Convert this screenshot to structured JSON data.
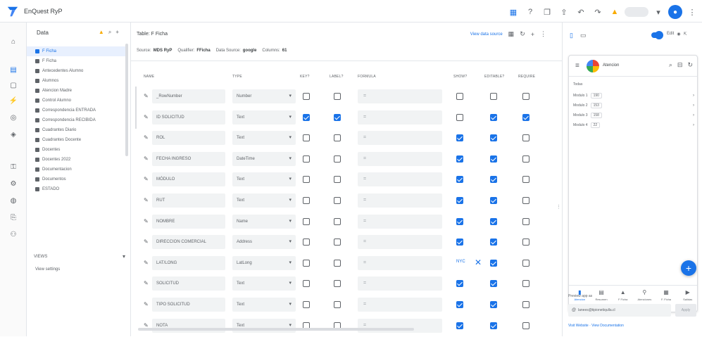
{
  "app": {
    "name": "EnQuest RyP"
  },
  "tables_panel": {
    "header": "Data",
    "items": [
      "F Ficha",
      "F Ficha",
      "Antecedentes Alumno",
      "Alumnos",
      "Atencion Madre",
      "Control Alumno",
      "Correspondencia ENTRADA",
      "Correspondencia RECIBIDA",
      "Cuadrantes Diario",
      "Cuadrantes Docente",
      "Docentes",
      "Docentes 2022",
      "Documentacion",
      "Documentos",
      "ESTADO"
    ],
    "views_header": "VIEWS",
    "views_item": "View settings"
  },
  "main": {
    "title": "Table: F Ficha",
    "link": "View data source",
    "meta": [
      {
        "label": "Source:",
        "value": "MDS RyP"
      },
      {
        "label": "Qualifier:",
        "value": "FFicha"
      },
      {
        "label": "Data Source:",
        "value": "google"
      },
      {
        "label": "Columns:",
        "value": "61"
      }
    ],
    "headers": {
      "name": "NAME",
      "type": "TYPE",
      "key": "KEY?",
      "label": "LABEL?",
      "formula": "FORMULA",
      "show": "SHOW?",
      "editable": "EDITABLE?",
      "require": "REQUIRE"
    },
    "rows": [
      {
        "name": "_RowNumber",
        "type": "Number",
        "formula": "=",
        "key": false,
        "label": false,
        "show": false,
        "editable": false,
        "require": false,
        "left_bar": true
      },
      {
        "name": "ID SOLICITUD",
        "type": "Text",
        "formula": "=",
        "key": true,
        "label": true,
        "show": false,
        "editable": true,
        "require": true,
        "left_bar": true
      },
      {
        "name": "ROL",
        "type": "Text",
        "formula": "=",
        "key": false,
        "label": false,
        "show": true,
        "editable": true,
        "require": false
      },
      {
        "name": "FECHA INGRESO",
        "type": "DateTime",
        "formula": "=",
        "key": false,
        "label": false,
        "show": true,
        "editable": true,
        "require": false
      },
      {
        "name": "MÓDULO",
        "type": "Text",
        "formula": "=",
        "key": false,
        "label": false,
        "show": true,
        "editable": true,
        "require": false
      },
      {
        "name": "RUT",
        "type": "Text",
        "formula": "=",
        "key": false,
        "label": false,
        "show": true,
        "editable": true,
        "require": false
      },
      {
        "name": "NOMBRE",
        "type": "Name",
        "formula": "=",
        "key": false,
        "label": false,
        "show": true,
        "editable": true,
        "require": false
      },
      {
        "name": "DIRECCION COMERCIAL",
        "type": "Address",
        "formula": "=",
        "key": false,
        "label": false,
        "show": true,
        "editable": true,
        "require": false
      },
      {
        "name": "LAT/LONG",
        "type": "LatLong",
        "formula": "=",
        "key": false,
        "label": false,
        "show": false,
        "editable": true,
        "require": false,
        "show_text": "NYC",
        "show_x": true
      },
      {
        "name": "SOLICITUD",
        "type": "Text",
        "formula": "=",
        "key": false,
        "label": false,
        "show": true,
        "editable": true,
        "require": false
      },
      {
        "name": "TIPO SOLICITUD",
        "type": "Text",
        "formula": "=",
        "key": false,
        "label": false,
        "show": true,
        "editable": true,
        "require": false
      },
      {
        "name": "NOTA",
        "type": "Text",
        "formula": "=",
        "key": false,
        "label": false,
        "show": true,
        "editable": true,
        "require": false
      }
    ]
  },
  "preview": {
    "edit_label": "Edit",
    "app_title": "Atencion",
    "group_label": "Todas",
    "list": [
      {
        "label": "Modulo 1",
        "value": "190"
      },
      {
        "label": "Modulo 2",
        "value": "153"
      },
      {
        "label": "Modulo 3",
        "value": "158"
      },
      {
        "label": "Modulo 4",
        "value": "22"
      }
    ],
    "nav": [
      "Atencion",
      "Resumen",
      "F Ficha",
      "Atenciones",
      "F. Ficha",
      "Salidas"
    ],
    "preview_as": "Preview app as",
    "email": "lanees@tipionetiqulla.cl",
    "apply": "Apply",
    "links": "Visit Website · View Documentation"
  }
}
